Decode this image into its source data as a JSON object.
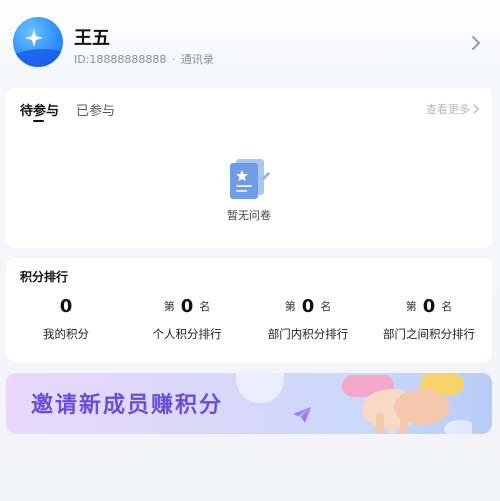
{
  "profile": {
    "name": "王五",
    "id_text": "ID:18888888888",
    "separator": "·",
    "contacts": "通讯录"
  },
  "surveys": {
    "tabs": [
      {
        "label": "待参与",
        "active": true
      },
      {
        "label": "已参与",
        "active": false
      }
    ],
    "more_label": "查看更多",
    "empty_text": "暂无问卷"
  },
  "ranking": {
    "title": "积分排行",
    "stats": [
      {
        "prefix": "",
        "value": "0",
        "suffix": "",
        "label": "我的积分"
      },
      {
        "prefix": "第",
        "value": "0",
        "suffix": "名",
        "label": "个人积分排行"
      },
      {
        "prefix": "第",
        "value": "0",
        "suffix": "名",
        "label": "部门内积分排行"
      },
      {
        "prefix": "第",
        "value": "0",
        "suffix": "名",
        "label": "部门之间积分排行"
      }
    ]
  },
  "banner": {
    "text": "邀请新成员赚积分"
  },
  "colors": {
    "accent": "#2f8cff",
    "banner_text": "#6b4ed8"
  }
}
